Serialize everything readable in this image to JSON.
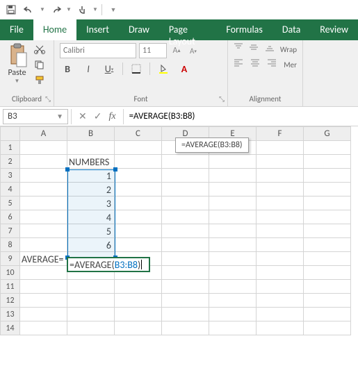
{
  "qat": {
    "save": "save",
    "undo": "undo",
    "redo": "redo"
  },
  "tabs": {
    "file": "File",
    "home": "Home",
    "insert": "Insert",
    "draw": "Draw",
    "pageLayout": "Page Layout",
    "formulas": "Formulas",
    "data": "Data",
    "review": "Review"
  },
  "ribbon": {
    "clipboard": {
      "paste": "Paste",
      "label": "Clipboard"
    },
    "font": {
      "namePlaceholder": "Calibri",
      "sizePlaceholder": "11",
      "bold": "B",
      "italic": "I",
      "underline": "U",
      "label": "Font"
    },
    "alignment": {
      "wrap": "Wrap",
      "merge": "Mer",
      "label": "Alignment"
    }
  },
  "namebox": {
    "value": "B3"
  },
  "formulaBar": {
    "value": "=AVERAGE(B3:B8)",
    "fxText": "fx"
  },
  "tooltip": "=AVERAGE(B3:B8)",
  "columns": [
    "A",
    "B",
    "C",
    "D",
    "E",
    "F",
    "G"
  ],
  "rows": [
    "1",
    "2",
    "3",
    "4",
    "5",
    "6",
    "7",
    "8",
    "9",
    "10",
    "11",
    "12",
    "13",
    "14"
  ],
  "cells": {
    "B2": "NUMBERS",
    "B3": "1",
    "B4": "2",
    "B5": "3",
    "B6": "4",
    "B7": "5",
    "B8": "6",
    "A9": "AVERAGE="
  },
  "editing": {
    "prefix": "=AVERAGE(",
    "ref": "B3:B8",
    "suffix": ")"
  }
}
